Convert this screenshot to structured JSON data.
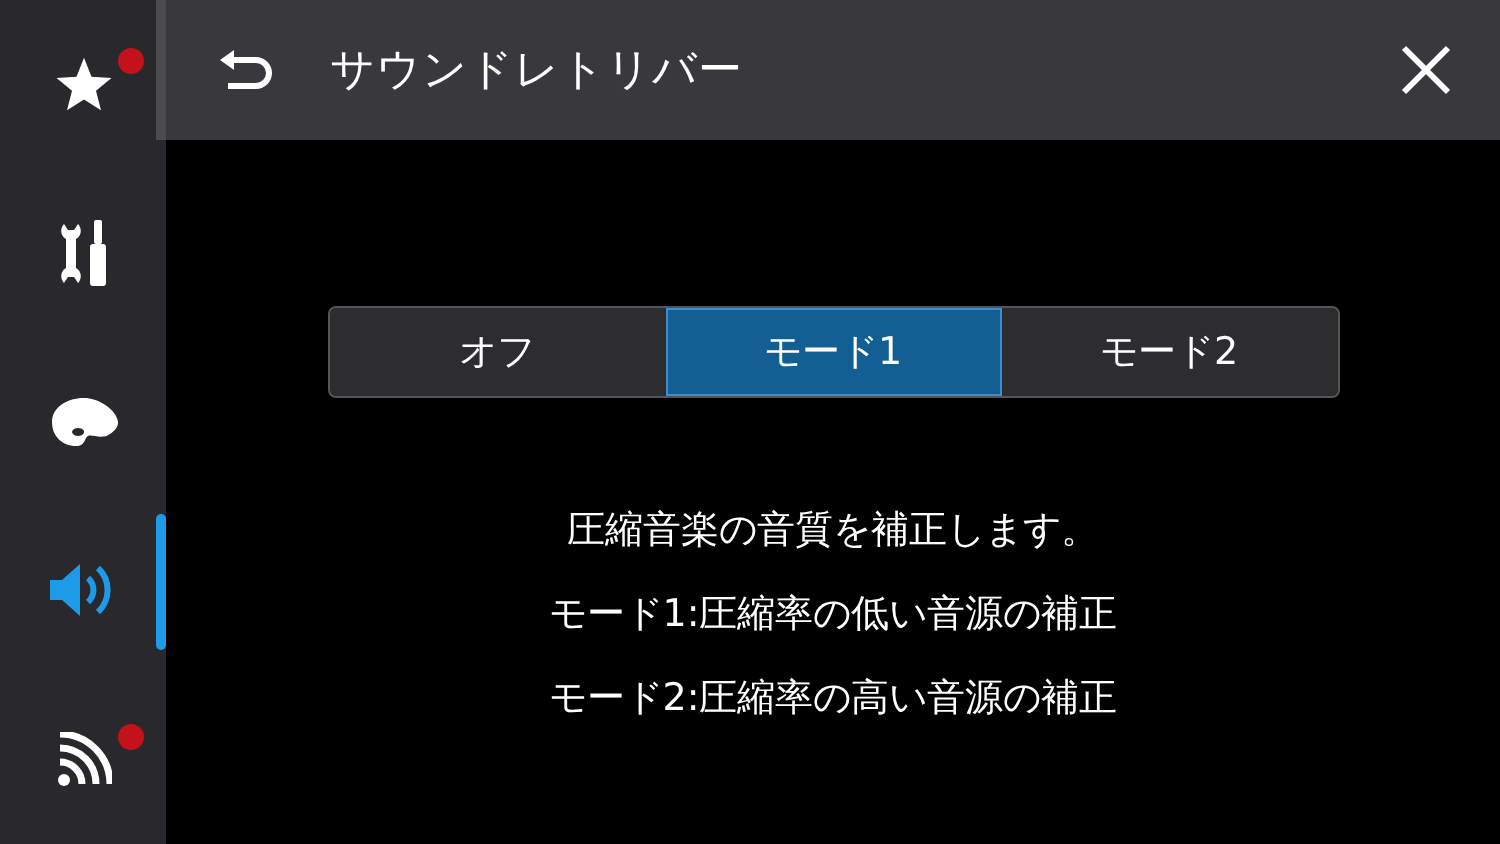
{
  "sidebar": {
    "items": [
      {
        "kind": "star",
        "selected": false,
        "badge": true
      },
      {
        "kind": "tools",
        "selected": false,
        "badge": false
      },
      {
        "kind": "palette",
        "selected": false,
        "badge": false
      },
      {
        "kind": "speaker",
        "selected": true,
        "badge": false
      },
      {
        "kind": "signal",
        "selected": false,
        "badge": true
      }
    ]
  },
  "header": {
    "title": "サウンドレトリバー"
  },
  "segments": [
    {
      "label": "オフ",
      "selected": false
    },
    {
      "label": "モード1",
      "selected": true
    },
    {
      "label": "モード2",
      "selected": false
    }
  ],
  "description": [
    "圧縮音楽の音質を補正します。",
    "モード1:圧縮率の低い音源の補正",
    "モード2:圧縮率の高い音源の補正"
  ]
}
